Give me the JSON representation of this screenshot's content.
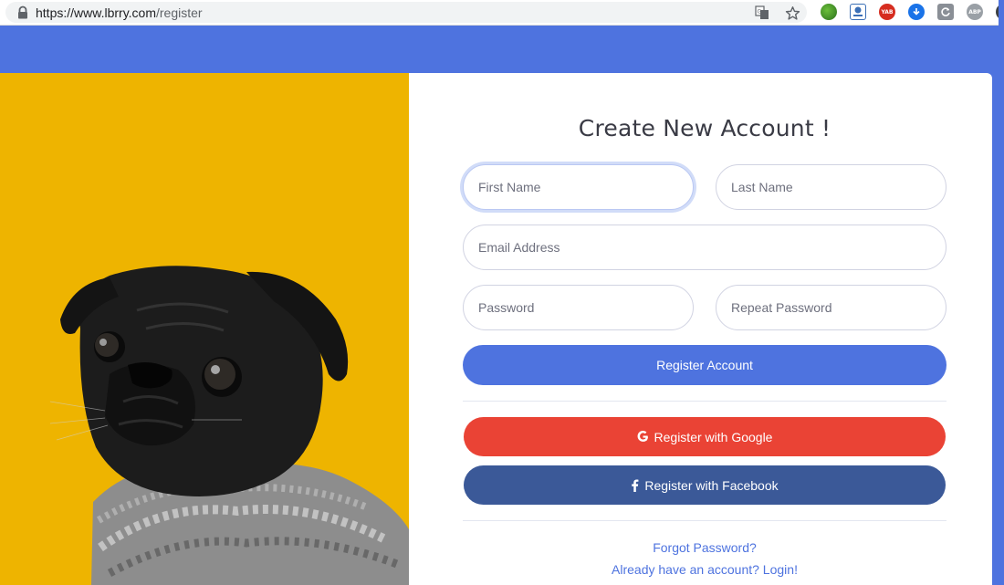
{
  "browser": {
    "url_host": "https://www.lbrry.com",
    "url_path": "/register"
  },
  "extensions": {
    "yab_label": "YAB",
    "abp_label": "ABP"
  },
  "form": {
    "title": "Create New Account !",
    "first_name_placeholder": "First Name",
    "last_name_placeholder": "Last Name",
    "email_placeholder": "Email Address",
    "password_placeholder": "Password",
    "repeat_password_placeholder": "Repeat Password",
    "register_button": "Register Account",
    "google_button": "Register with Google",
    "facebook_button": "Register with Facebook",
    "forgot_password_link": "Forgot Password?",
    "login_link": "Already have an account? Login!"
  },
  "colors": {
    "primary": "#4e73df",
    "google": "#ea4335",
    "facebook": "#3b5998",
    "photo_background": "#eeb400"
  }
}
